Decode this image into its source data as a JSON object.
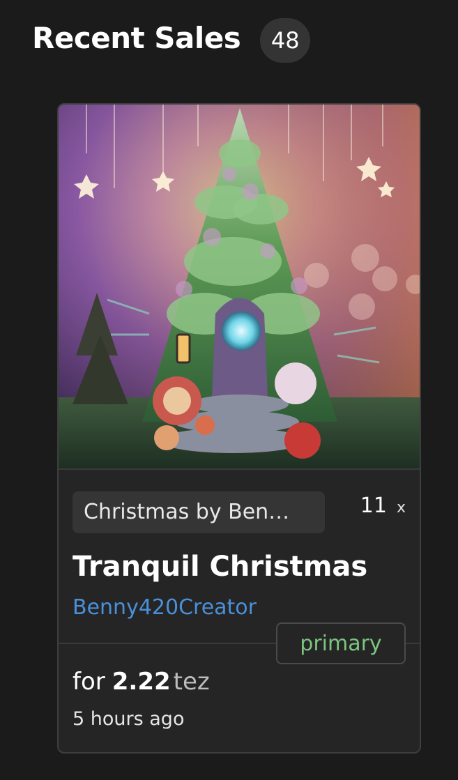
{
  "header": {
    "title": "Recent Sales",
    "count": "48"
  },
  "sale": {
    "artwork_icon": "christmas-tree-artwork",
    "collection": "Christmas by Ben…",
    "edition_count": "11",
    "edition_suffix": "x",
    "title": "Tranquil Christmas",
    "creator": "Benny420Creator",
    "sale_type": "primary",
    "price_prefix": "for",
    "price_value": "2.22",
    "price_unit": "tez",
    "time_ago": "5 hours ago"
  },
  "colors": {
    "background": "#1b1b1b",
    "card": "#252525",
    "creator_link": "#4a90d9",
    "primary_badge": "#7cc47f"
  }
}
